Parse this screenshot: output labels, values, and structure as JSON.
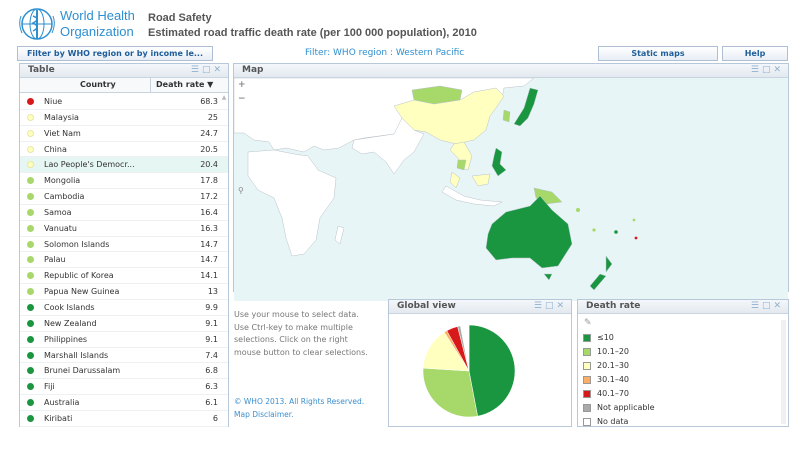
{
  "header": {
    "org_line1": "World Health",
    "org_line2": "Organization",
    "app_title": "Road Safety",
    "subtitle": "Estimated road traffic death rate (per 100 000 population), 2010"
  },
  "toolbar": {
    "filter_button": "Filter by WHO region or by income le...",
    "filter_status": "Filter:  WHO region :  Western Pacific",
    "static_maps": "Static maps",
    "help": "Help"
  },
  "colors": {
    "lte10": "#1a9641",
    "c10_20": "#a6d96a",
    "c20_30": "#ffffbf",
    "c30_40": "#fdae61",
    "c40_70": "#d7191c",
    "na": "#aaaaaa",
    "nodata": "#ffffff",
    "ocean": "#e8f5f7",
    "land": "#ffffff"
  },
  "table": {
    "title": "Table",
    "col_country": "Country",
    "col_rate": "Death rate  ▼",
    "rows": [
      {
        "country": "Niue",
        "rate": "68.3",
        "color": "#d7191c"
      },
      {
        "country": "Malaysia",
        "rate": "25",
        "color": "#ffffbf"
      },
      {
        "country": "Viet Nam",
        "rate": "24.7",
        "color": "#ffffbf"
      },
      {
        "country": "China",
        "rate": "20.5",
        "color": "#ffffbf"
      },
      {
        "country": "Lao People's Democr...",
        "rate": "20.4",
        "color": "#ffffbf"
      },
      {
        "country": "Mongolia",
        "rate": "17.8",
        "color": "#a6d96a"
      },
      {
        "country": "Cambodia",
        "rate": "17.2",
        "color": "#a6d96a"
      },
      {
        "country": "Samoa",
        "rate": "16.4",
        "color": "#a6d96a"
      },
      {
        "country": "Vanuatu",
        "rate": "16.3",
        "color": "#a6d96a"
      },
      {
        "country": "Solomon Islands",
        "rate": "14.7",
        "color": "#a6d96a"
      },
      {
        "country": "Palau",
        "rate": "14.7",
        "color": "#a6d96a"
      },
      {
        "country": "Republic of Korea",
        "rate": "14.1",
        "color": "#a6d96a"
      },
      {
        "country": "Papua New Guinea",
        "rate": "13",
        "color": "#a6d96a"
      },
      {
        "country": "Cook Islands",
        "rate": "9.9",
        "color": "#1a9641"
      },
      {
        "country": "New Zealand",
        "rate": "9.1",
        "color": "#1a9641"
      },
      {
        "country": "Philippines",
        "rate": "9.1",
        "color": "#1a9641"
      },
      {
        "country": "Marshall Islands",
        "rate": "7.4",
        "color": "#1a9641"
      },
      {
        "country": "Brunei Darussalam",
        "rate": "6.8",
        "color": "#1a9641"
      },
      {
        "country": "Fiji",
        "rate": "6.3",
        "color": "#1a9641"
      },
      {
        "country": "Australia",
        "rate": "6.1",
        "color": "#1a9641"
      },
      {
        "country": "Kiribati",
        "rate": "6",
        "color": "#1a9641"
      }
    ]
  },
  "map": {
    "title": "Map",
    "zoom_in": "+",
    "zoom_out": "−"
  },
  "instructions": "Use your mouse to select data.  Use Ctrl-key to make multiple selections. Click on the right mouse button to clear selections.",
  "copyright": "© WHO 2013. All Rights Reserved. Map Disclaimer.",
  "global_view": {
    "title": "Global view",
    "slices": [
      {
        "label": "≤10",
        "value": 47,
        "color": "#1a9641"
      },
      {
        "label": "10.1–20",
        "value": 29,
        "color": "#a6d96a"
      },
      {
        "label": "20.1–30",
        "value": 15,
        "color": "#ffffbf"
      },
      {
        "label": "30.1–40",
        "value": 1,
        "color": "#fdae61"
      },
      {
        "label": "40.1–70",
        "value": 4,
        "color": "#d7191c"
      },
      {
        "label": "Not applicable",
        "value": 1,
        "color": "#aaaaaa"
      },
      {
        "label": "No data",
        "value": 3,
        "color": "#ffffff"
      }
    ]
  },
  "legend": {
    "title": "Death rate",
    "items": [
      {
        "label": "≤10",
        "color": "#1a9641"
      },
      {
        "label": "10.1–20",
        "color": "#a6d96a"
      },
      {
        "label": "20.1–30",
        "color": "#ffffbf"
      },
      {
        "label": "30.1–40",
        "color": "#fdae61"
      },
      {
        "label": "40.1–70",
        "color": "#d7191c"
      },
      {
        "label": "Not applicable",
        "color": "#aaaaaa"
      },
      {
        "label": "No data",
        "color": "#ffffff"
      }
    ]
  }
}
